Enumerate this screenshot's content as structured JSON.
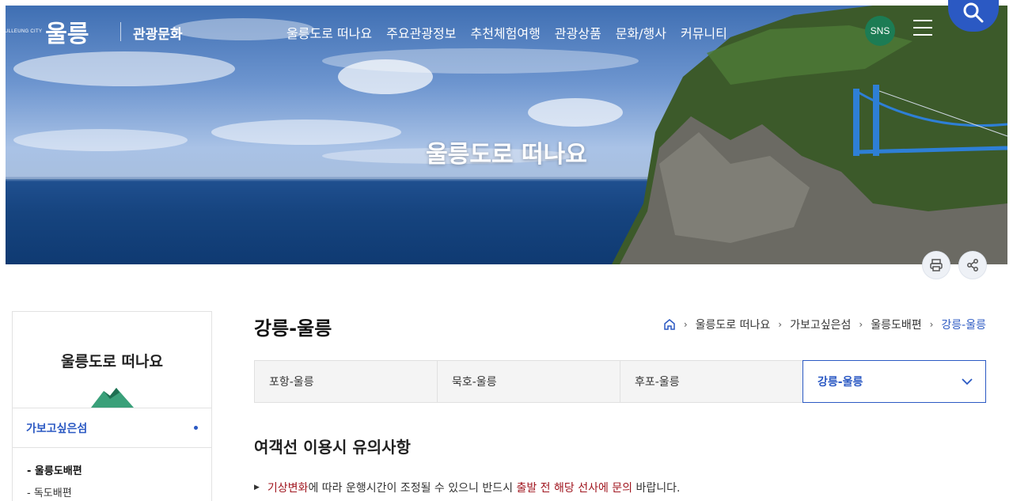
{
  "header": {
    "logo_small": "ULLEUNG CITY",
    "logo_big": "울릉",
    "site_name": "관광문화",
    "nav": [
      "울릉도로 떠나요",
      "주요관광정보",
      "추천체험여행",
      "관광상품",
      "문화/행사",
      "커뮤니티"
    ],
    "sns_label": "SNS"
  },
  "hero": {
    "title": "울릉도로 떠나요"
  },
  "sidebar": {
    "title": "울릉도로 떠나요",
    "current": "가보고싶은섬",
    "sub_items": [
      "울릉도배편",
      "독도배편"
    ]
  },
  "main": {
    "title": "강릉-울릉",
    "breadcrumb": [
      "울릉도로 떠나요",
      "가보고싶은섬",
      "울릉도배편",
      "강릉-울릉"
    ],
    "tabs": [
      "포항-울릉",
      "묵호-울릉",
      "후포-울릉",
      "강릉-울릉"
    ],
    "section_title": "여객선 이용시 유의사항",
    "notice": {
      "part1": "기상변화",
      "part2": "에 따라 운행시간이 조정될 수 있으니 반드시 ",
      "part3": "출발 전 해당 선사에 문의",
      "part4": " 바랍니다."
    }
  },
  "colors": {
    "accent": "#2b59c3",
    "sns": "#1c7c54",
    "highlight": "#a0161f"
  }
}
